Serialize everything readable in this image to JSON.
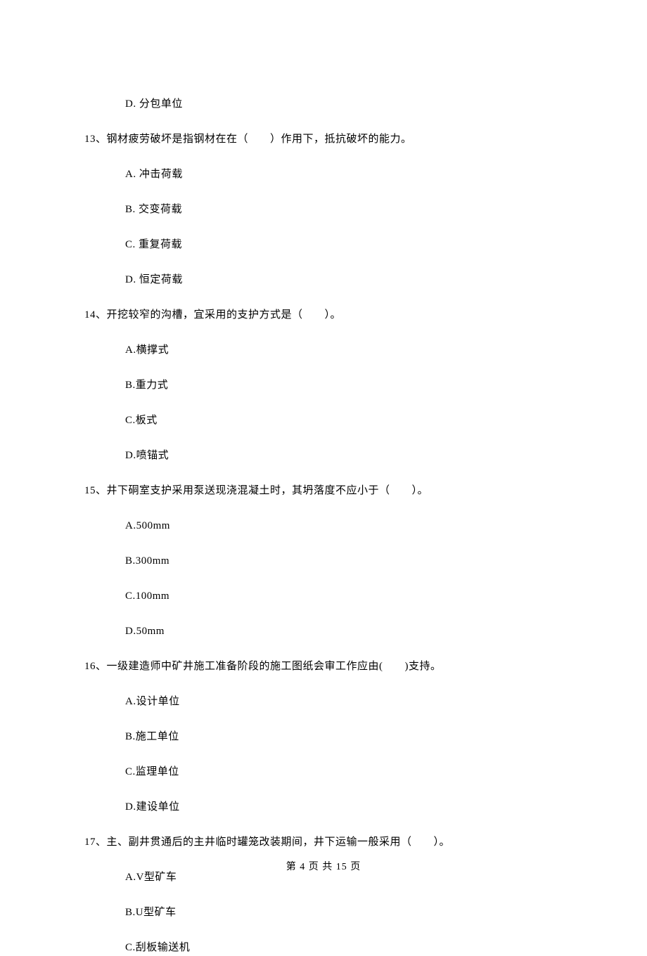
{
  "orphan_option": "D. 分包单位",
  "q13": {
    "stem": "13、钢材疲劳破坏是指钢材在在（　　）作用下，抵抗破坏的能力。",
    "A": "A. 冲击荷载",
    "B": "B. 交变荷载",
    "C": "C. 重复荷载",
    "D": "D. 恒定荷载"
  },
  "q14": {
    "stem": "14、开挖较窄的沟槽，宜采用的支护方式是（　　）。",
    "A": "A.横撑式",
    "B": "B.重力式",
    "C": "C.板式",
    "D": "D.喷锚式"
  },
  "q15": {
    "stem": "15、井下硐室支护采用泵送现浇混凝土时，其坍落度不应小于（　　）。",
    "A": "A.500mm",
    "B": "B.300mm",
    "C": "C.100mm",
    "D": "D.50mm"
  },
  "q16": {
    "stem": "16、一级建造师中矿井施工准备阶段的施工图纸会审工作应由(　　)支持。",
    "A": "A.设计单位",
    "B": "B.施工单位",
    "C": "C.监理单位",
    "D": "D.建设单位"
  },
  "q17": {
    "stem": "17、主、副井贯通后的主井临时罐笼改装期间，井下运输一般采用（　　）。",
    "A": "A.V型矿车",
    "B": "B.U型矿车",
    "C": "C.刮板输送机"
  },
  "footer": "第 4 页 共 15 页"
}
